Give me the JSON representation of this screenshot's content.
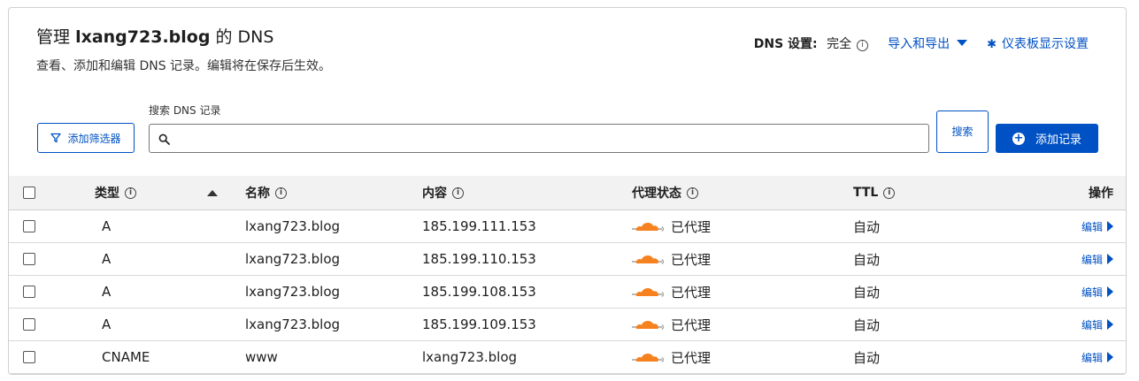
{
  "header": {
    "title_prefix": "管理",
    "domain": "lxang723.blog",
    "title_suffix": "的 DNS",
    "subtitle": "查看、添加和编辑 DNS 记录。编辑将在保存后生效。",
    "dns_setting_label": "DNS 设置:",
    "dns_setting_value": "完全",
    "import_export": "导入和导出",
    "dashboard_settings": "仪表板显示设置"
  },
  "toolbar": {
    "filter_button": "添加筛选器",
    "search_label": "搜索 DNS 记录",
    "search_value": "",
    "search_button": "搜索",
    "add_record_button": "添加记录"
  },
  "table": {
    "columns": {
      "type": "类型",
      "name": "名称",
      "content": "内容",
      "proxy": "代理状态",
      "ttl": "TTL",
      "actions": "操作"
    },
    "rows": [
      {
        "type": "A",
        "name": "lxang723.blog",
        "content": "185.199.111.153",
        "proxy": "已代理",
        "ttl": "自动",
        "action": "编辑"
      },
      {
        "type": "A",
        "name": "lxang723.blog",
        "content": "185.199.110.153",
        "proxy": "已代理",
        "ttl": "自动",
        "action": "编辑"
      },
      {
        "type": "A",
        "name": "lxang723.blog",
        "content": "185.199.108.153",
        "proxy": "已代理",
        "ttl": "自动",
        "action": "编辑"
      },
      {
        "type": "A",
        "name": "lxang723.blog",
        "content": "185.199.109.153",
        "proxy": "已代理",
        "ttl": "自动",
        "action": "编辑"
      },
      {
        "type": "CNAME",
        "name": "www",
        "content": "lxang723.blog",
        "proxy": "已代理",
        "ttl": "自动",
        "action": "编辑"
      }
    ]
  },
  "colors": {
    "accent": "#0051c3",
    "cloud": "#f6821f"
  },
  "icons": [
    "info-icon",
    "caret-down-icon",
    "gear-icon",
    "filter-icon",
    "search-icon",
    "plus-circle-icon",
    "sort-up-icon",
    "cloud-proxied-icon",
    "chevron-right-icon"
  ]
}
